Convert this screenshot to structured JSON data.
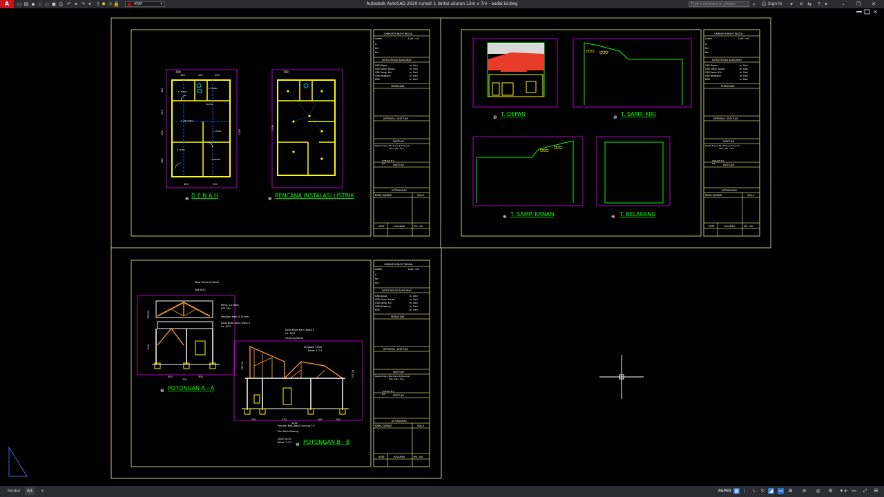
{
  "app": {
    "logo": "A",
    "title": "Autodesk AutoCAD 2020   rumah 1 lantai ukuran 12m x 7m - asdar.id.dwg",
    "layer": "ATAP",
    "search_placeholder": "Type a keyword or phrase",
    "sign_in": "Sign In"
  },
  "status": {
    "tabs": [
      "Model",
      "A3"
    ],
    "add_tab": "+",
    "space": "PAPER"
  },
  "sheet1": {
    "denah_title": "D E N A H",
    "listrik_title": "RENCANA INSTALASI LISTRIK",
    "dims": {
      "top_total": "700",
      "top_a": "300",
      "top_b": "200",
      "top_c": "200",
      "bottom_a": "400",
      "bottom_b": "300",
      "left_a": "300",
      "left_b": "120",
      "left_c": "300",
      "left_d": "280",
      "right_total": "1200",
      "listrik_top": "700",
      "listrik_left": "1200"
    },
    "rooms": [
      "K. TIDUR",
      "K. MANDI",
      "DAPUR",
      "R. KELUARGA",
      "K. TIDUR",
      "R. TAMU",
      "CARPORT"
    ]
  },
  "sheet2": {
    "depan": "T. DEPAN",
    "kiri": "T. SAMP. KIRI",
    "kanan": "T. SAMP. KANAN",
    "belakang": "T. BELAKANG"
  },
  "sheet3": {
    "pot_a": "POTONGAN A - A",
    "pot_b": "POTONGAN B - B",
    "notes_a": [
      "Atap Genteng Metal",
      "Nok 8/12",
      "Reng. 1/2 Batu",
      "kP2.4Px",
      "Ventilasi Besi Ø 10 mm",
      "Kuda-Kuda Kayu Klass II",
      "uk. 6/12"
    ],
    "notes_b": [
      "Kuda-Kuda Kayu Klass II",
      "uk. 6/12",
      "Genteng Metal",
      "Ringbalk 15/20",
      "Beton 1:2:3"
    ],
    "notes_foot": [
      "Pondasi Batu Batu Gunung 1:3",
      "Pas. Batu Kosong",
      "Sloof 15/20",
      "Beton 1:2:3"
    ],
    "dims_a": [
      "400",
      "300",
      "700"
    ],
    "dims_b": [
      "150",
      "370",
      "300",
      "150",
      "1200"
    ],
    "dims_vert_a": [
      "370/20",
      "240"
    ],
    "dims_vert_b": [
      "337.50",
      "157.20"
    ]
  },
  "titleblock": {
    "project": "GAMBAR RUMAH TINGGAL",
    "luas_label": "Lokasi :",
    "luas_unit": "Luas : m2",
    "addr": [
      "Jl.",
      "Kel.",
      "Kec."
    ],
    "kepala": "KATEGORISASI BANGUNAN",
    "items": [
      "GSB Depan",
      "GSB Samp. Kanan",
      "GSB Samp. Kiri",
      "GSB Belakang",
      "KDB"
    ],
    "item_vals": [
      "m, Dari",
      "m, Dari",
      "m, Dari",
      "m, Dari",
      "m, Dari"
    ],
    "perencana": "PERENCANA",
    "diperiksa": "DIPERIKSA / DISETUJUI",
    "disetujui": "DISETUJUI",
    "kabid": "Kepala Bidang Tata Ruang & Bangunan",
    "kota": "Kota / Kab. : Bins",
    "nip": "S.PISAUD.M.S",
    "nip2": "NIP.",
    "keterangan": "KETERANGAN",
    "nama_gambar": "NAMA GAMBAR",
    "skala": "SKALA",
    "footer": [
      "ADDF",
      "HALAMAN",
      "JML. HAL"
    ]
  },
  "colors": {
    "sheet_border": "#c8c878",
    "frame": "#b400c8",
    "wall": "#ffff00",
    "label": "#00ff00",
    "roof": "#e63c28",
    "dim": "#00c8ff",
    "wood": "#e08a2a"
  }
}
